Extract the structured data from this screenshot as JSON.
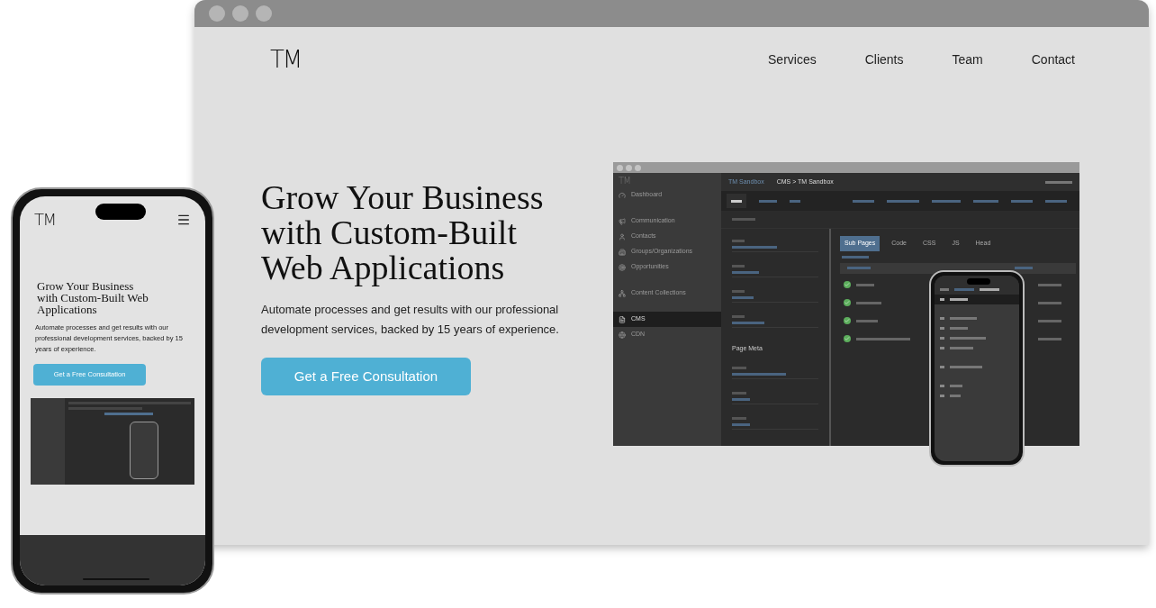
{
  "browser": {
    "nav": {
      "logo": "TM",
      "links": [
        "Services",
        "Clients",
        "Team",
        "Contact"
      ]
    },
    "hero": {
      "heading": "Grow Your Business with Custom-Built Web Applications",
      "text": "Automate processes and get results with our professional development services, backed by 15 years of experience.",
      "button": "Get a Free Consultation"
    },
    "cms": {
      "logo": "TM",
      "brand": "TM Sandbox",
      "breadcrumb": "CMS > TM Sandbox",
      "sidebar": [
        {
          "label": "Dashboard",
          "selected": false
        },
        {
          "label": "Communication",
          "selected": false
        },
        {
          "label": "Contacts",
          "selected": false
        },
        {
          "label": "Groups/Organizations",
          "selected": false
        },
        {
          "label": "Opportunities",
          "selected": false
        },
        {
          "label": "Content Collections",
          "selected": false
        },
        {
          "label": "CMS",
          "selected": true
        },
        {
          "label": "CDN",
          "selected": false
        }
      ],
      "section": "Page Meta",
      "subtabs": [
        {
          "label": "Sub Pages",
          "selected": true
        },
        {
          "label": "Code",
          "selected": false
        },
        {
          "label": "CSS",
          "selected": false
        },
        {
          "label": "JS",
          "selected": false
        },
        {
          "label": "Head",
          "selected": false
        }
      ]
    }
  },
  "phone": {
    "logo": "TM",
    "heading": "Grow Your Business with Custom-Built Web Applications",
    "text": "Automate processes and get results with our professional development services, backed by 15 years of experience.",
    "button": "Get a Free Consultation"
  }
}
